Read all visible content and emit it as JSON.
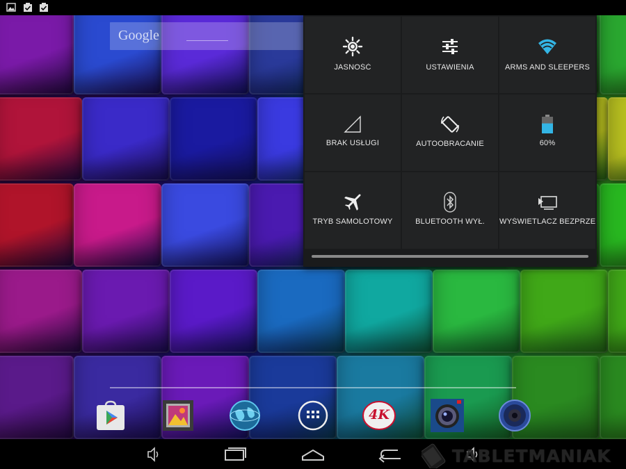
{
  "statusbar": {
    "icons": [
      "image-notification-icon",
      "clipboard-check-icon",
      "clipboard-check-icon"
    ]
  },
  "search": {
    "logo": "Google"
  },
  "quick_settings": {
    "tiles": [
      {
        "label": "JASNOŚĆ",
        "icon": "brightness-icon"
      },
      {
        "label": "USTAWIENIA",
        "icon": "settings-sliders-icon"
      },
      {
        "label": "ARMS AND SLEEPERS",
        "icon": "wifi-icon"
      },
      {
        "label": "BRAK USŁUGI",
        "icon": "cell-signal-icon"
      },
      {
        "label": "AUTOOBRACANIE",
        "icon": "auto-rotate-icon"
      },
      {
        "label": "60%",
        "icon": "battery-icon",
        "level": 0.6
      },
      {
        "label": "TRYB SAMOLOTOWY",
        "icon": "airplane-icon"
      },
      {
        "label": "BLUETOOTH WYŁ.",
        "icon": "bluetooth-icon"
      },
      {
        "label": "WYŚWIETLACZ BEZPRZE...",
        "icon": "cast-screen-icon"
      }
    ],
    "accent": "#33b5e5"
  },
  "dock": {
    "apps": [
      "play-store-icon",
      "gallery-icon",
      "browser-globe-icon",
      "app-drawer-icon",
      "4k-player-icon",
      "camera-icon",
      "speaker-icon"
    ],
    "fourk_label": "4K"
  },
  "navbar": {
    "buttons": [
      "volume-down-icon",
      "recents-icon",
      "home-icon",
      "back-icon",
      "volume-up-icon"
    ]
  },
  "watermark": {
    "text": "TABLETMANIAK"
  }
}
